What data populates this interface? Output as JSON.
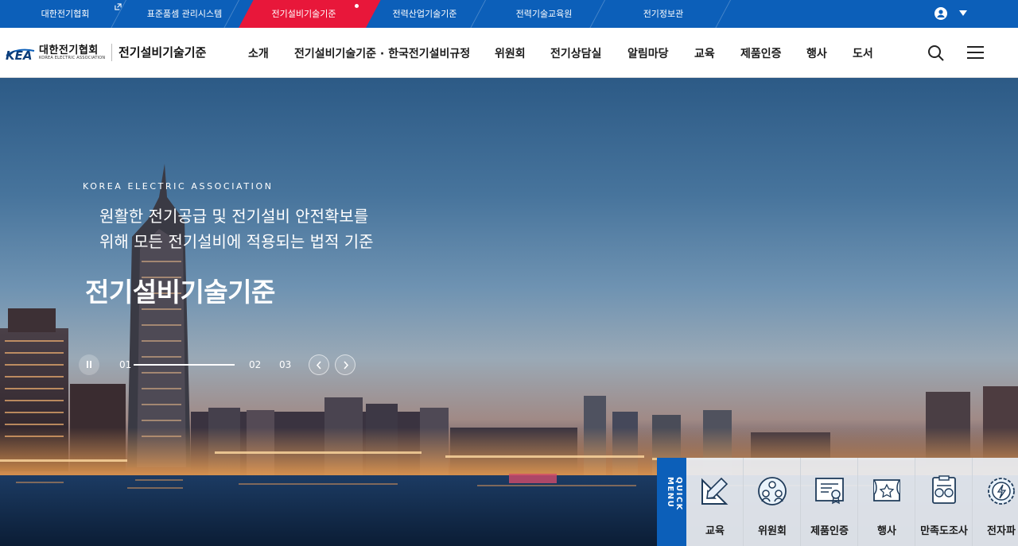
{
  "topbar": {
    "tabs": [
      "대한전기협회",
      "표준품셈 관리시스템",
      "전기설비기술기준",
      "전력산업기술기준",
      "전력기술교육원",
      "전기정보관"
    ],
    "active_tab": "전기설비기술기준",
    "icons": [
      "external-link-icon",
      "user-icon",
      "caret-down-icon"
    ]
  },
  "header": {
    "logo_ko": "대한전기협회",
    "logo_en": "KOREA ELECTRIC ASSOCIATION",
    "logo_mark": "KEA",
    "site_title": "전기설비기술기준",
    "nav": [
      "소개",
      "전기설비기술기준 · 한국전기설비규정",
      "위원회",
      "전기상담실",
      "알림마당",
      "교육",
      "제품인증",
      "행사",
      "도서"
    ],
    "icons": [
      "search-icon",
      "hamburger-menu-icon"
    ]
  },
  "hero": {
    "eyebrow": "KOREA ELECTRIC ASSOCIATION",
    "lead_line1": "원활한 전기공급 및 전기설비 안전확보를",
    "lead_line2": "위해 모든 전기설비에 적용되는 법적 기준",
    "title": "전기설비기술기준",
    "slides": [
      "01",
      "02",
      "03"
    ],
    "current_slide": "01",
    "progress": 1.0
  },
  "quick_menu": {
    "label": "QUICK MENU",
    "items": [
      "교육",
      "위원회",
      "제품인증",
      "행사",
      "만족도조사",
      "전자파"
    ],
    "icons": [
      "ruler-triangle-icon",
      "committee-people-icon",
      "certificate-icon",
      "event-stage-icon",
      "survey-icon",
      "electromagnetic-icon"
    ]
  },
  "colors": {
    "brand_blue": "#0c5fb9",
    "active_red": "#e8173a"
  }
}
